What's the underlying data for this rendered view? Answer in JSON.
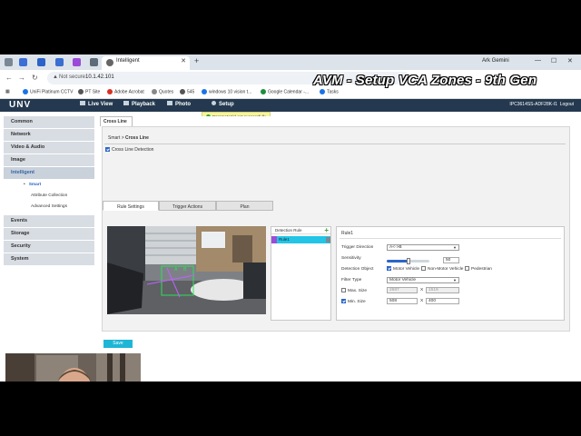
{
  "browser": {
    "tab_title": "Intelligent",
    "new_tab": "+",
    "profile": "Ark Gemini",
    "security": "Not secure",
    "url": "10.1.42.101",
    "bookmarks": [
      {
        "label": "UniFi Platinum CCTV",
        "color": "#1a73e8"
      },
      {
        "label": "PT Site",
        "color": "#555555"
      },
      {
        "label": "Adobe Acrobat",
        "color": "#d93025"
      },
      {
        "label": "Quotes",
        "color": "#888888"
      },
      {
        "label": "545",
        "color": "#555555"
      },
      {
        "label": "windows 10 vision t...",
        "color": "#1a73e8"
      },
      {
        "label": "Google Calendar -...",
        "color": "#1e8e3e"
      },
      {
        "label": "Tasks",
        "color": "#1a73e8"
      }
    ]
  },
  "overlay_title": "AVM - Setup VCA Zones - 9th Gen",
  "app": {
    "logo": "UNV",
    "nav": [
      "Live View",
      "Playback",
      "Photo",
      "Setup"
    ],
    "device": "IPC3614SS-ADF28K-I1",
    "logout": "Logout",
    "toast": "Parameter(s) set successfully",
    "sidebar": {
      "items": [
        "Common",
        "Network",
        "Video & Audio",
        "Image",
        "Intelligent",
        "Events",
        "Storage",
        "Security",
        "System"
      ],
      "sub_items": [
        "Smart",
        "Attribute Collection",
        "Advanced Settings"
      ]
    },
    "page_tab": "Cross Line",
    "breadcrumb": {
      "parent": "Smart",
      "sep": ">",
      "current": "Cross Line"
    },
    "enable_label": "Cross Line Detection",
    "subtabs": [
      "Rule Settings",
      "Trigger Actions",
      "Plan"
    ],
    "rules": {
      "header": "Detection Rule",
      "add": "+",
      "items": [
        "Rule1"
      ]
    },
    "settings": {
      "rule_name": "Rule1",
      "trigger_direction_label": "Trigger Direction",
      "trigger_direction_value": "A<->B",
      "sensitivity_label": "Sensitivity",
      "sensitivity_value": "50",
      "sensitivity_fraction": 0.5,
      "detection_object_label": "Detection Object",
      "objects": [
        "Motor Vehicle",
        "Non-Motor Vehicle",
        "Pedestrian"
      ],
      "filter_type_label": "Filter Type",
      "filter_type_value": "Motor Vehicle",
      "max_size_label": "Max. Size",
      "max_w": "2687",
      "max_h": "1519",
      "min_size_label": "Min. Size",
      "min_w": "508",
      "min_h": "400",
      "x": "X"
    },
    "video_labels": [
      "A",
      "B"
    ],
    "save": "Save"
  }
}
